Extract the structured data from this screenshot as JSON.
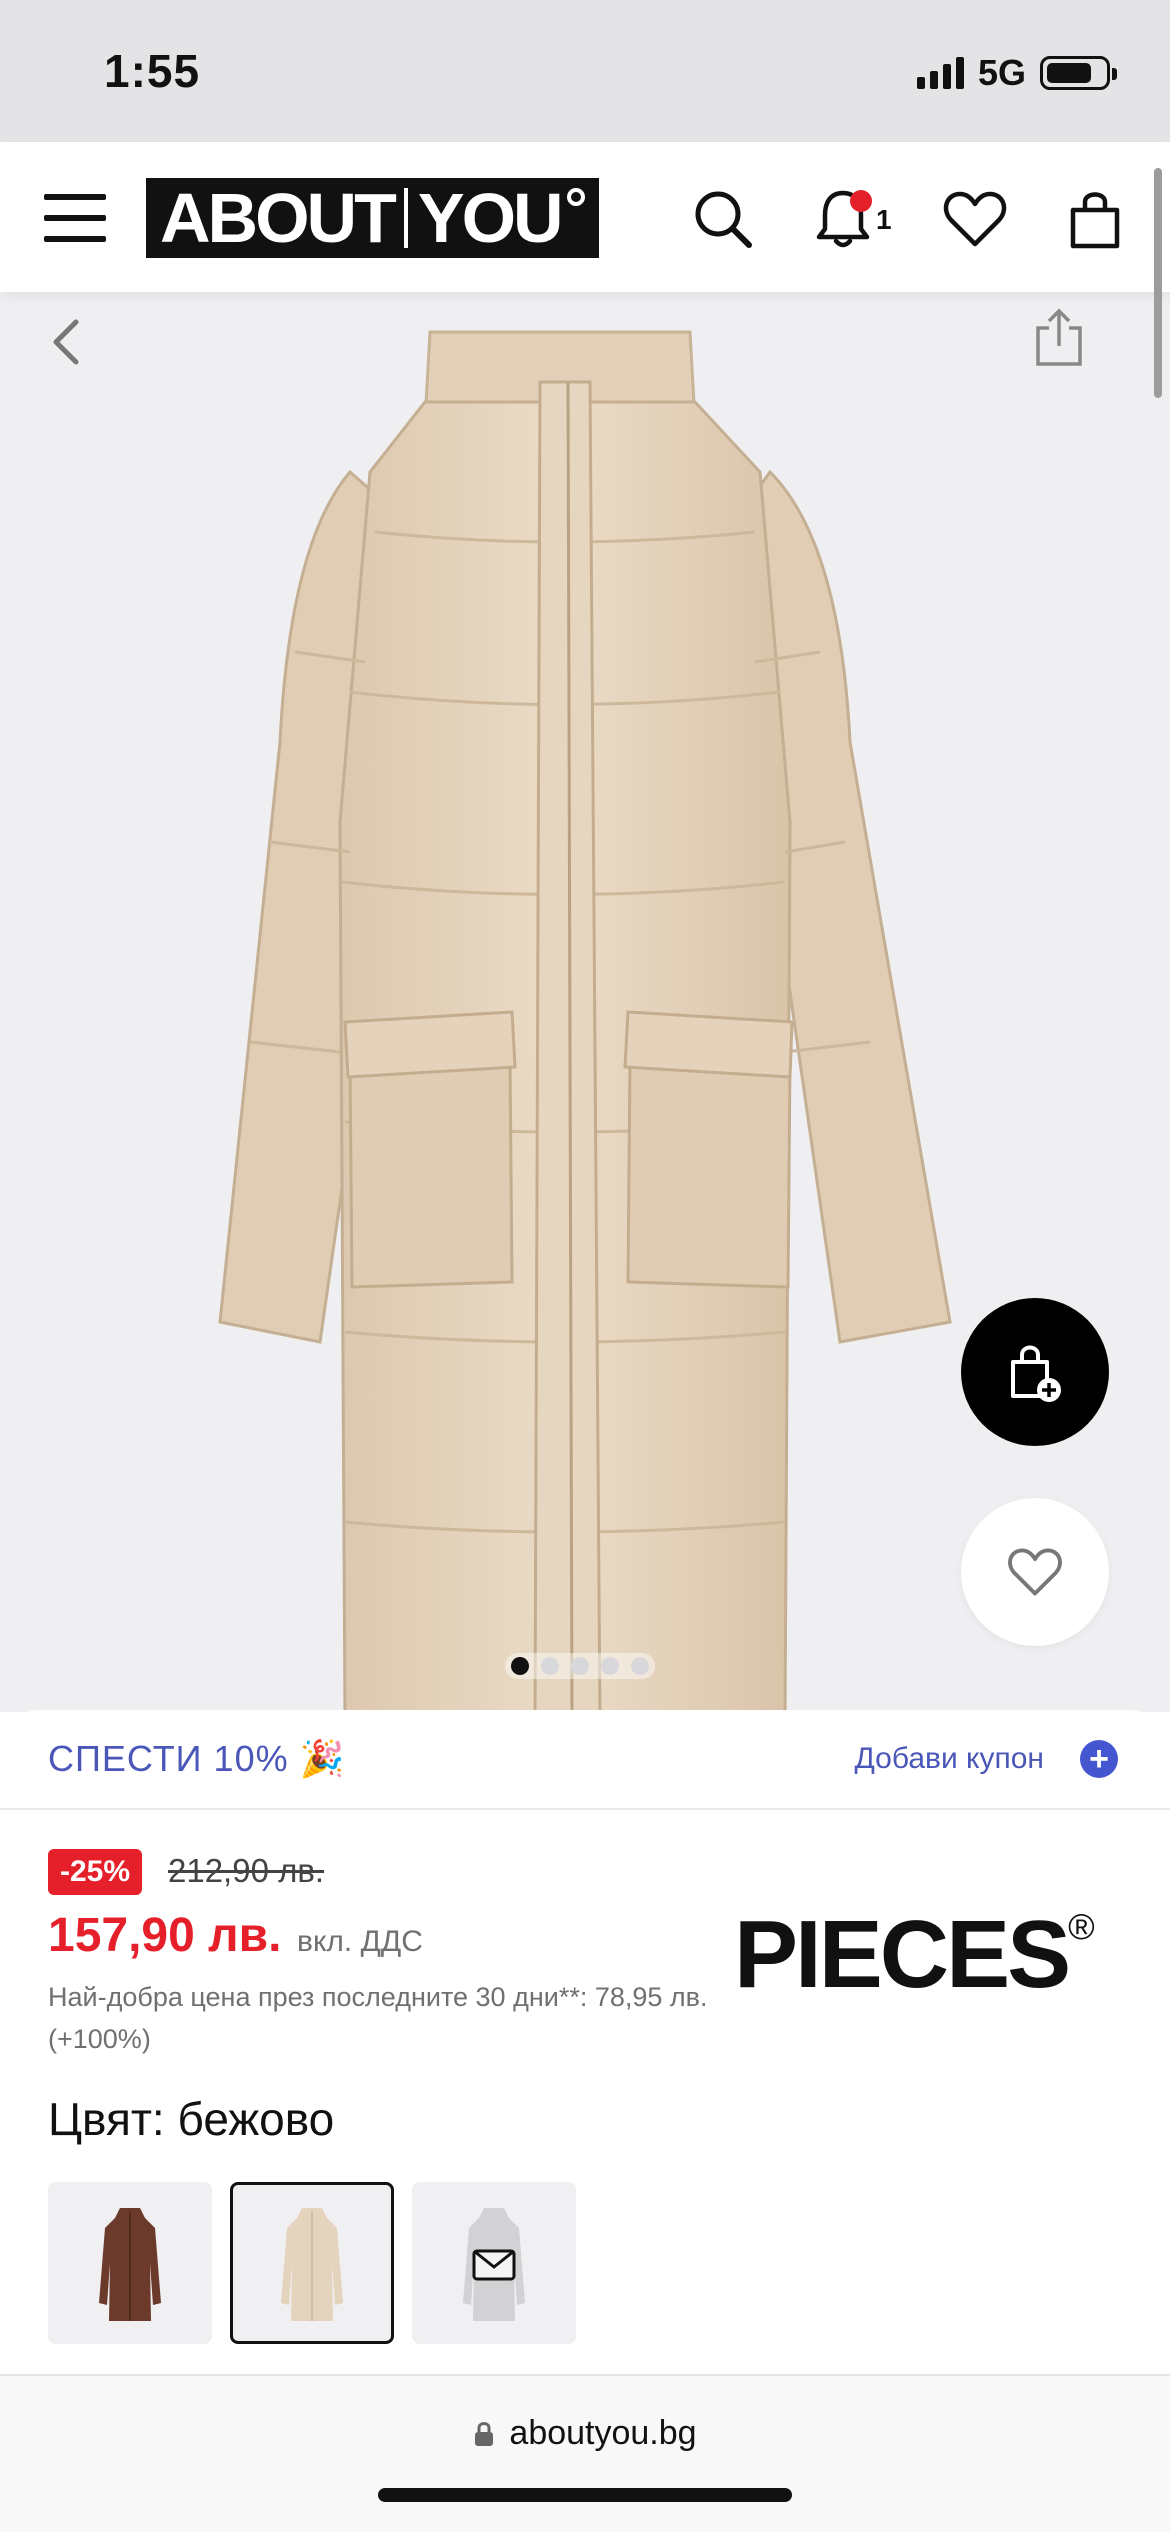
{
  "status_bar": {
    "time": "1:55",
    "network": "5G"
  },
  "header": {
    "logo_left": "ABOUT",
    "logo_right": "YOU",
    "notification_count": "1",
    "icons": [
      "menu-icon",
      "search-icon",
      "bell-icon",
      "heart-icon",
      "bag-icon"
    ]
  },
  "product": {
    "image_pages": 5,
    "active_page": 1,
    "main_color_hex": "#e5d4bd"
  },
  "coupon": {
    "text": "СПЕСТИ 10% 🎉",
    "link": "Добави купон",
    "plus": "+"
  },
  "price": {
    "discount": "-25%",
    "old_price": "212,90 лв.",
    "new_price": "157,90 лв.",
    "vat_note": "вкл. ДДС",
    "lowest_price_note": "Най-добра цена през последните 30 дни**: 78,95 лв. (+100%)",
    "accent": "#e5202a"
  },
  "brand": {
    "name": "PIECES",
    "registered": "®"
  },
  "color": {
    "label": "Цвят: бежово",
    "options": [
      {
        "name": "brown",
        "hex": "#6b3a2a"
      },
      {
        "name": "beige",
        "hex": "#e5d4bd"
      },
      {
        "name": "grey",
        "hex": "#d2d2d4"
      }
    ],
    "selected": "beige"
  },
  "browser": {
    "url": "aboutyou.bg"
  }
}
